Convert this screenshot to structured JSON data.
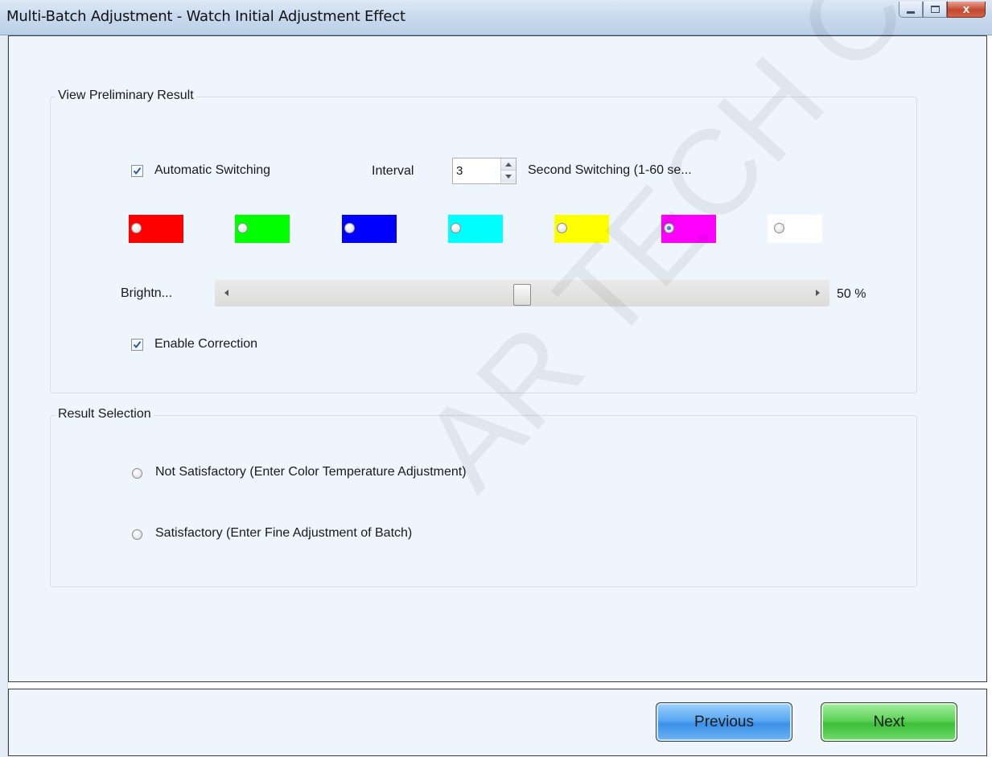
{
  "window": {
    "title": "Multi-Batch Adjustment - Watch Initial Adjustment Effect",
    "close_glyph": "x"
  },
  "preview_group": {
    "title": "View Preliminary Result",
    "auto_switching": {
      "label": "Automatic Switching",
      "checked": true
    },
    "interval_label": "Interval",
    "interval_value": "3",
    "interval_suffix": "Second Switching (1-60 se...",
    "color_options": [
      {
        "color": "#ff0000",
        "selected": false
      },
      {
        "color": "#00ff00",
        "selected": false
      },
      {
        "color": "#0000ff",
        "selected": false
      },
      {
        "color": "#00ffff",
        "selected": false
      },
      {
        "color": "#ffff00",
        "selected": false
      },
      {
        "color": "#ff00ff",
        "selected": true
      },
      {
        "color": "#ffffff",
        "selected": false
      }
    ],
    "brightness_label": "Brightn...",
    "brightness_value": 50,
    "brightness_text": "50 %",
    "enable_correction": {
      "label": "Enable Correction",
      "checked": true
    }
  },
  "result_group": {
    "title": "Result Selection",
    "options": [
      {
        "label": "Not Satisfactory (Enter Color Temperature Adjustment)",
        "selected": false
      },
      {
        "label": "Satisfactory (Enter Fine Adjustment of Batch)",
        "selected": false
      }
    ]
  },
  "footer": {
    "previous_label": "Previous",
    "next_label": "Next"
  },
  "watermark": "AR TECH CO., L"
}
